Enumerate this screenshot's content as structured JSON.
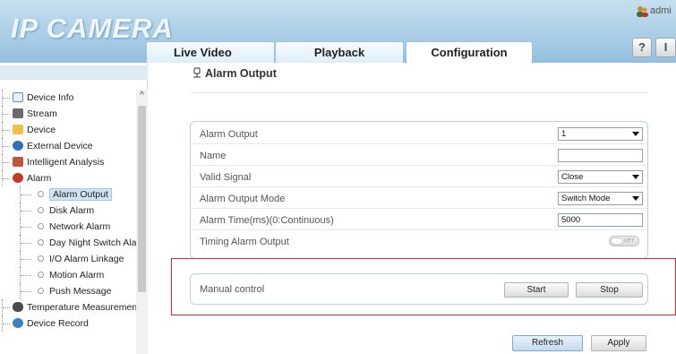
{
  "header": {
    "logo": "IP CAMERA",
    "tabs": [
      {
        "label": "Live Video"
      },
      {
        "label": "Playback"
      },
      {
        "label": "Configuration"
      }
    ],
    "user": "admi",
    "help_icon_glyph": "?",
    "logout_icon_glyph": "I"
  },
  "sidebar": {
    "items": [
      {
        "label": "Device Info",
        "icon": "document-icon"
      },
      {
        "label": "Stream",
        "icon": "film-icon"
      },
      {
        "label": "Device",
        "icon": "folder-icon"
      },
      {
        "label": "External Device",
        "icon": "plug-icon"
      },
      {
        "label": "Intelligent Analysis",
        "icon": "analysis-icon"
      },
      {
        "label": "Alarm",
        "icon": "alarm-icon"
      },
      {
        "label": "Temperature Measurement",
        "icon": "thermometer-icon"
      },
      {
        "label": "Device Record",
        "icon": "record-icon"
      }
    ],
    "alarm_children": [
      {
        "label": "Alarm Output",
        "selected": true
      },
      {
        "label": "Disk Alarm"
      },
      {
        "label": "Network Alarm"
      },
      {
        "label": "Day Night Switch Alarm"
      },
      {
        "label": "I/O Alarm Linkage"
      },
      {
        "label": "Motion Alarm"
      },
      {
        "label": "Push Message"
      }
    ]
  },
  "main": {
    "title": "Alarm Output",
    "form": {
      "alarm_output": {
        "label": "Alarm Output",
        "value": "1"
      },
      "name": {
        "label": "Name",
        "value": ""
      },
      "valid_signal": {
        "label": "Valid Signal",
        "value": "Close"
      },
      "mode": {
        "label": "Alarm Output Mode",
        "value": "Switch Mode"
      },
      "alarm_time": {
        "label": "Alarm Time(ms)(0:Continuous)",
        "value": "5000"
      },
      "timing": {
        "label": "Timing Alarm Output",
        "toggle_text": "OFF"
      }
    },
    "manual": {
      "label": "Manual control",
      "start": "Start",
      "stop": "Stop"
    },
    "refresh": "Refresh",
    "apply": "Apply"
  },
  "colors": {
    "header_bg": "#a9cde6",
    "highlight_border": "#e0262f",
    "selected_bg": "#cfe3f4"
  }
}
